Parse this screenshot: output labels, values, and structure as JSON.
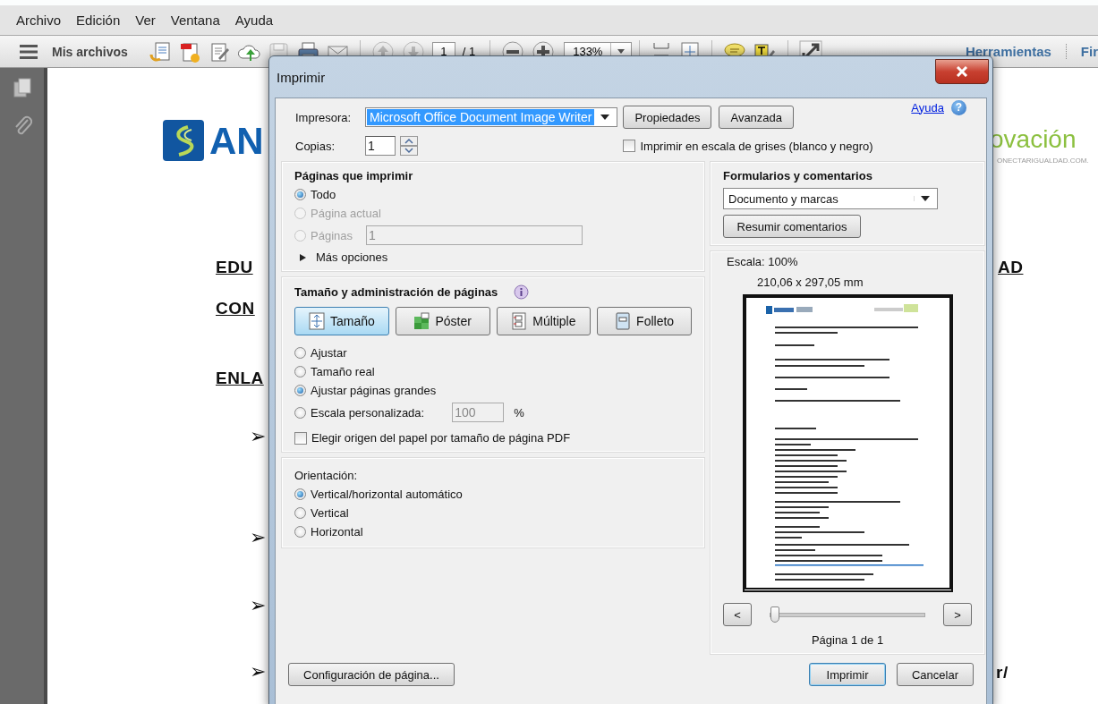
{
  "menu_bar": [
    "Archivo",
    "Edición",
    "Ver",
    "Ventana",
    "Ayuda"
  ],
  "toolbar": {
    "menu_label": "Mis archivos",
    "page_number": "1",
    "page_total": "/ 1",
    "zoom": "133%",
    "tools_label": "Herramientas",
    "sign_label": "Fir"
  },
  "document": {
    "logo_text": "AN",
    "partner_logo": "ovación",
    "partner_url": "ONECTARIGUALDAD.COM.",
    "headings": [
      "EDU",
      "CON",
      "ENLA"
    ],
    "right_fragments": [
      "AD",
      "r/"
    ],
    "bullets": [
      "➢",
      "➢",
      "➢",
      "➢"
    ]
  },
  "dialog": {
    "title": "Imprimir",
    "printer": {
      "label": "Impresora:",
      "value": "Microsoft Office Document Image Writer"
    },
    "top_buttons": [
      "Propiedades",
      "Avanzada"
    ],
    "help_link": "Ayuda",
    "help_button": "?",
    "copies": {
      "label": "Copias:",
      "value": "1"
    },
    "grayscale": {
      "label": "Imprimir en escala de grises (blanco y negro)",
      "checked": false
    },
    "pages_section": {
      "title": "Páginas que imprimir",
      "options": [
        {
          "label": "Todo",
          "selected": true,
          "disabled": false
        },
        {
          "label": "Página actual",
          "selected": false,
          "disabled": true
        },
        {
          "label": "Páginas",
          "selected": false,
          "disabled": true,
          "field": "1"
        }
      ],
      "more_options": {
        "label": "Más opciones",
        "expanded": false
      }
    },
    "page_handling": {
      "title": "Tamaño y administración de páginas",
      "modes": [
        {
          "label": "Tamaño",
          "selected": true
        },
        {
          "label": "Póster",
          "selected": false
        },
        {
          "label": "Múltiple",
          "selected": false
        },
        {
          "label": "Folleto",
          "selected": false
        }
      ],
      "scaling": [
        {
          "label": "Ajustar",
          "selected": false
        },
        {
          "label": "Tamaño real",
          "selected": false
        },
        {
          "label": "Ajustar páginas grandes",
          "selected": true
        },
        {
          "label": "Escala personalizada:",
          "selected": false,
          "field": "100",
          "unit": "%"
        }
      ],
      "paper_source": {
        "label": "Elegir origen del papel por tamaño de página PDF",
        "checked": false
      }
    },
    "orientation": {
      "title": "Orientación:",
      "options": [
        {
          "label": "Vertical/horizontal automático",
          "selected": true
        },
        {
          "label": "Vertical",
          "selected": false
        },
        {
          "label": "Horizontal",
          "selected": false
        }
      ]
    },
    "comments": {
      "title": "Formularios y comentarios",
      "value": "Documento y marcas",
      "button": "Resumir comentarios"
    },
    "preview": {
      "scale": "Escala: 100%",
      "size": "210,06 x 297,05 mm",
      "prev": "<",
      "next": ">",
      "slider": {
        "level": 0
      },
      "page_label": "Página 1 de 1"
    },
    "page_setup_button": "Configuración de página...",
    "actions": [
      {
        "label": "Imprimir",
        "default": true
      },
      {
        "label": "Cancelar",
        "default": false
      }
    ]
  }
}
